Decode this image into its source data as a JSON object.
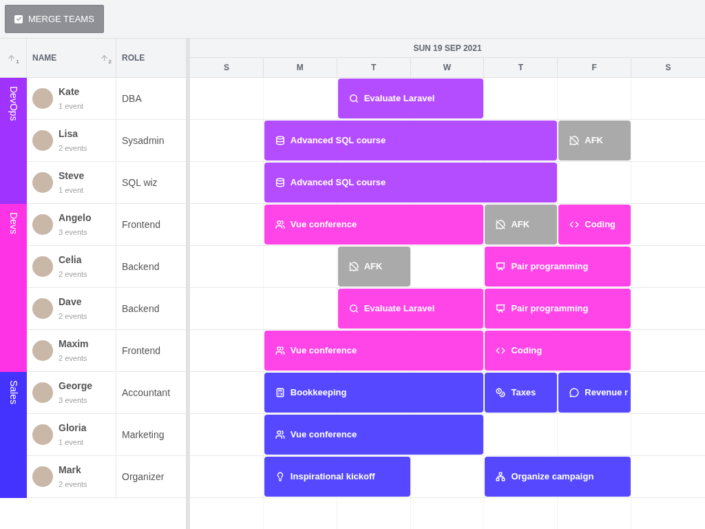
{
  "toolbar": {
    "merge_button": {
      "label": "MERGE TEAMS",
      "checked": true
    }
  },
  "columns": {
    "group_sort": "1",
    "name": "NAME",
    "name_sort": "2",
    "role": "ROLE"
  },
  "timeline": {
    "title": "SUN 19 SEP 2021",
    "days": [
      "S",
      "M",
      "T",
      "W",
      "T",
      "F",
      "S"
    ]
  },
  "groups": [
    {
      "name": "DevOps",
      "color": "#a033ff",
      "rows": [
        {
          "name": "Kate",
          "events_count": "1 event",
          "role": "DBA",
          "events": [
            {
              "label": "Evaluate Laravel",
              "kind": "search",
              "color": "#b44dff"
            }
          ]
        },
        {
          "name": "Lisa",
          "events_count": "2 events",
          "role": "Sysadmin",
          "events": [
            {
              "label": "Advanced SQL course",
              "kind": "database",
              "color": "#b44dff"
            },
            {
              "label": "AFK",
              "kind": "away",
              "color": "#aaaaaa"
            }
          ]
        },
        {
          "name": "Steve",
          "events_count": "1 event",
          "role": "SQL wiz",
          "events": [
            {
              "label": "Advanced SQL course",
              "kind": "database",
              "color": "#b44dff"
            }
          ]
        }
      ]
    },
    {
      "name": "Devs",
      "color": "#ff33e6",
      "rows": [
        {
          "name": "Angelo",
          "events_count": "3 events",
          "role": "Frontend",
          "events": [
            {
              "label": "Vue conference",
              "kind": "people",
              "color": "#ff44e8"
            },
            {
              "label": "AFK",
              "kind": "away",
              "color": "#aaaaaa"
            },
            {
              "label": "Coding",
              "kind": "code",
              "color": "#ff44e8"
            }
          ]
        },
        {
          "name": "Celia",
          "events_count": "2 events",
          "role": "Backend",
          "events": [
            {
              "label": "AFK",
              "kind": "away",
              "color": "#aaaaaa"
            },
            {
              "label": "Pair programming",
              "kind": "screen",
              "color": "#ff44e8"
            }
          ]
        },
        {
          "name": "Dave",
          "events_count": "2 events",
          "role": "Backend",
          "events": [
            {
              "label": "Evaluate Laravel",
              "kind": "search",
              "color": "#ff44e8"
            },
            {
              "label": "Pair programming",
              "kind": "screen",
              "color": "#ff44e8"
            }
          ]
        },
        {
          "name": "Maxim",
          "events_count": "2 events",
          "role": "Frontend",
          "events": [
            {
              "label": "Vue conference",
              "kind": "people",
              "color": "#ff44e8"
            },
            {
              "label": "Coding",
              "kind": "code",
              "color": "#ff44e8"
            }
          ]
        }
      ]
    },
    {
      "name": "Sales",
      "color": "#4433ff",
      "rows": [
        {
          "name": "George",
          "events_count": "3 events",
          "role": "Accountant",
          "events": [
            {
              "label": "Bookkeeping",
              "kind": "register",
              "color": "#5548ff"
            },
            {
              "label": "Taxes",
              "kind": "coins",
              "color": "#5548ff"
            },
            {
              "label": "Revenue r",
              "kind": "chat",
              "color": "#5548ff"
            }
          ]
        },
        {
          "name": "Gloria",
          "events_count": "1 event",
          "role": "Marketing",
          "events": [
            {
              "label": "Vue conference",
              "kind": "people",
              "color": "#5548ff"
            }
          ]
        },
        {
          "name": "Mark",
          "events_count": "2 events",
          "role": "Organizer",
          "events": [
            {
              "label": "Inspirational kickoff",
              "kind": "bulb",
              "color": "#5548ff"
            },
            {
              "label": "Organize campaign",
              "kind": "network",
              "color": "#5548ff"
            }
          ]
        }
      ]
    }
  ]
}
